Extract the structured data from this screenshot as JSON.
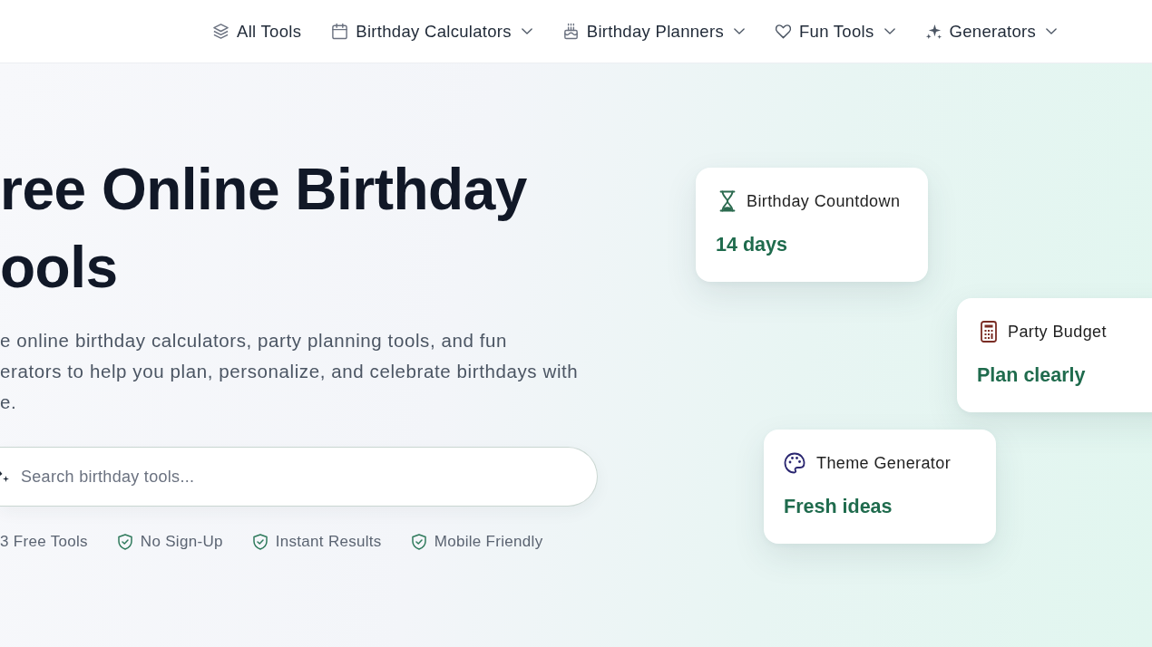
{
  "nav": {
    "items": [
      {
        "label": "All Tools",
        "dropdown": false
      },
      {
        "label": "Birthday Calculators",
        "dropdown": true
      },
      {
        "label": "Birthday Planners",
        "dropdown": true
      },
      {
        "label": "Fun Tools",
        "dropdown": true
      },
      {
        "label": "Generators",
        "dropdown": true
      }
    ]
  },
  "hero": {
    "title_lines": [
      "ree Online Birthday",
      "ools"
    ],
    "description_lines": [
      "e online birthday calculators, party planning tools, and fun",
      "erators to help you plan, personalize, and celebrate birthdays with",
      "e."
    ],
    "search": {
      "placeholder": "Search birthday tools..."
    },
    "badges": [
      {
        "label": "3 Free Tools",
        "icon_shown": false
      },
      {
        "label": "No Sign-Up",
        "icon_shown": true
      },
      {
        "label": "Instant Results",
        "icon_shown": true
      },
      {
        "label": "Mobile Friendly",
        "icon_shown": true
      }
    ]
  },
  "cards": [
    {
      "title": "Birthday Countdown",
      "value": "14 days"
    },
    {
      "title": "Party Budget",
      "value": "Plan clearly"
    },
    {
      "title": "Theme Generator",
      "value": "Fresh ideas"
    }
  ]
}
